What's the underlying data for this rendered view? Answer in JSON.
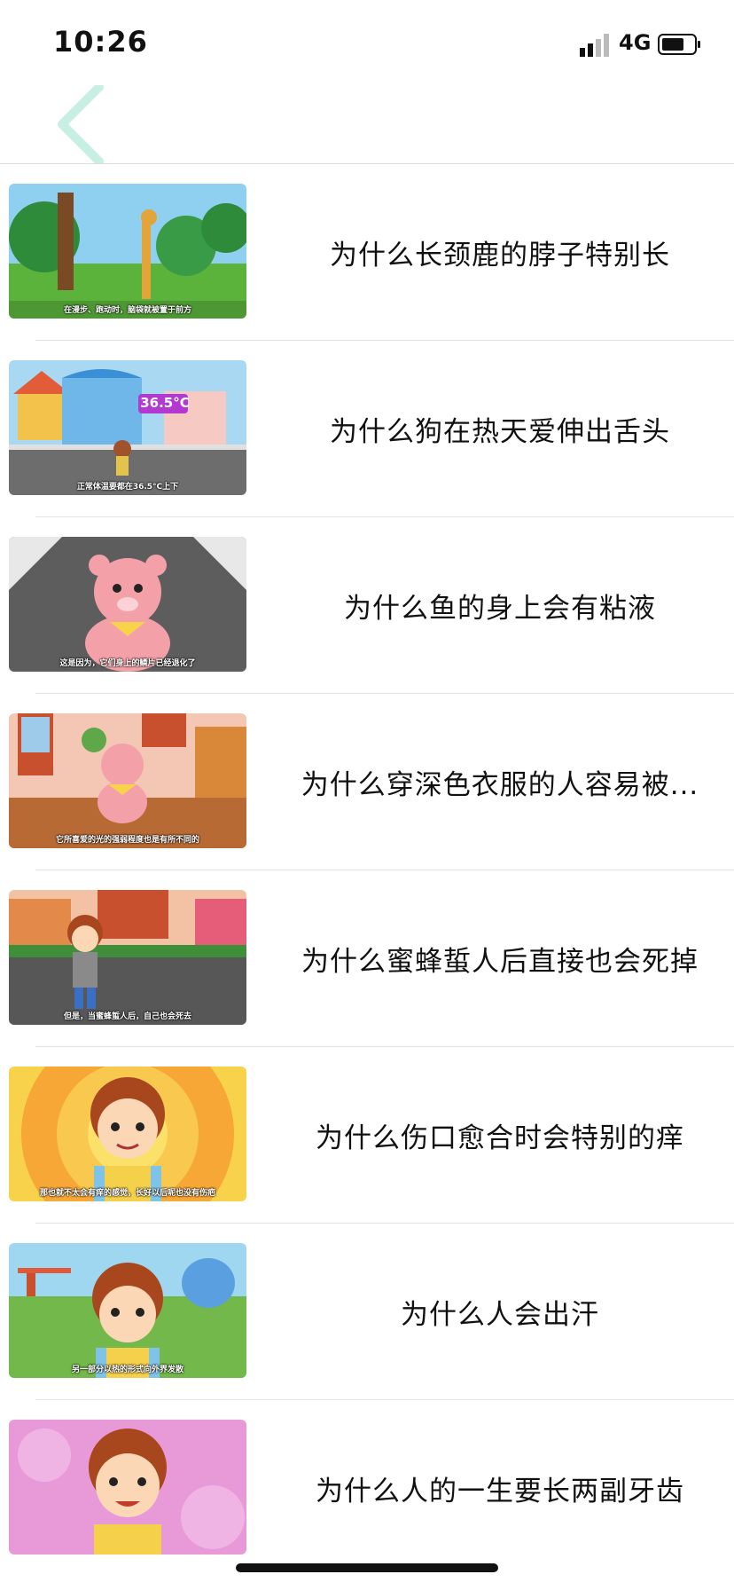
{
  "status_bar": {
    "time": "10:26",
    "network": "4G"
  },
  "nav": {
    "back_icon": "chevron-left-icon",
    "accent_color": "#c8efe4"
  },
  "items": [
    {
      "title": "为什么长颈鹿的脖子特别长",
      "caption": "在漫步、跑动时，脑袋就被置于前方",
      "thumb_theme": "giraffe-forest"
    },
    {
      "title": "为什么狗在热天爱伸出舌头",
      "caption": "正常体温要都在36.5°C上下",
      "badge": "36.5°C",
      "thumb_theme": "street-houses"
    },
    {
      "title": "为什么鱼的身上会有粘液",
      "caption": "这是因为，它们身上的鳞片已经退化了",
      "thumb_theme": "pink-bear-road"
    },
    {
      "title": "为什么穿深色衣服的人容易被...",
      "caption": "它所喜爱的光的强弱程度也是有所不同的",
      "thumb_theme": "bear-room"
    },
    {
      "title": "为什么蜜蜂蜇人后直接也会死掉",
      "caption": "但是，当蜜蜂蜇人后，自己也会死去",
      "thumb_theme": "boy-street"
    },
    {
      "title": "为什么伤口愈合时会特别的痒",
      "caption": "那也就不太会有痒的感觉，长好以后呢也没有伤疤",
      "thumb_theme": "boy-sunburst"
    },
    {
      "title": "为什么人会出汗",
      "caption": "另一部分以热的形式向外界发散",
      "thumb_theme": "boy-playground"
    },
    {
      "title": "为什么人的一生要长两副牙齿",
      "caption": "",
      "thumb_theme": "boy-pink"
    }
  ]
}
